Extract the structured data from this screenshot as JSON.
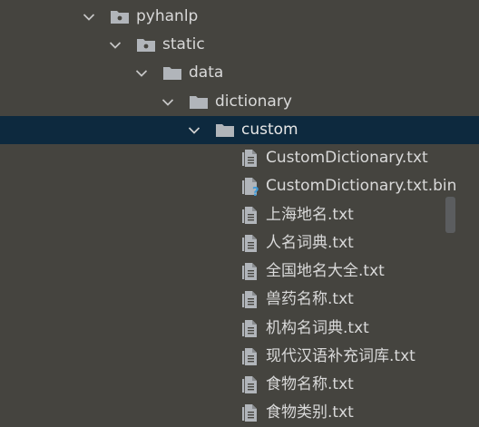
{
  "tree": {
    "items": [
      {
        "label": "pyhanlp",
        "type": "package-folder",
        "expanded": true
      },
      {
        "label": "static",
        "type": "package-folder",
        "expanded": true
      },
      {
        "label": "data",
        "type": "folder",
        "expanded": true
      },
      {
        "label": "dictionary",
        "type": "folder",
        "expanded": true
      },
      {
        "label": "custom",
        "type": "folder",
        "expanded": true,
        "selected": true
      },
      {
        "label": "CustomDictionary.txt",
        "type": "text-file"
      },
      {
        "label": "CustomDictionary.txt.bin",
        "type": "unknown-file"
      },
      {
        "label": "上海地名.txt",
        "type": "text-file"
      },
      {
        "label": "人名词典.txt",
        "type": "text-file"
      },
      {
        "label": "全国地名大全.txt",
        "type": "text-file"
      },
      {
        "label": "兽药名称.txt",
        "type": "text-file"
      },
      {
        "label": "机构名词典.txt",
        "type": "text-file"
      },
      {
        "label": "现代汉语补充词库.txt",
        "type": "text-file"
      },
      {
        "label": "食物名称.txt",
        "type": "text-file"
      },
      {
        "label": "食物类别.txt",
        "type": "text-file"
      }
    ]
  },
  "colors": {
    "background": "#45443f",
    "selection": "#0d293e",
    "folder_icon": "#b1b5ba",
    "file_icon": "#b1b5ba",
    "unknown_badge": "#3d9ad9"
  },
  "icons": {
    "chevron": "chevron-down-icon",
    "package_folder": "package-folder-icon",
    "folder": "folder-icon",
    "text_file": "text-file-icon",
    "unknown_file": "unknown-file-icon"
  }
}
